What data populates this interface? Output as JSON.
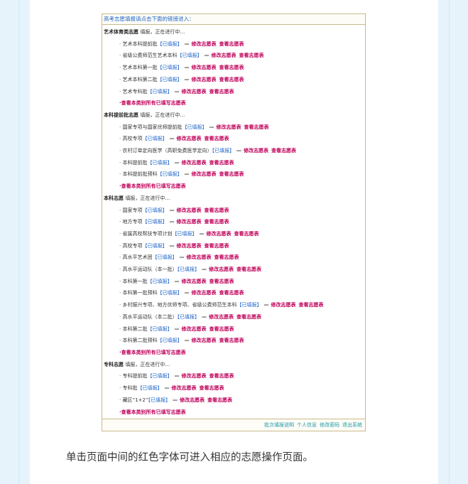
{
  "header": "高考志愿填报请点击下面的链接进入：",
  "status_text": "填报，正在进行中…",
  "filled_tag": "【已填报】",
  "dash": "—",
  "modify_label": "修改志愿表",
  "view_label": "查看志愿表",
  "view_all_label": "·查看本类别所有已填写志愿表",
  "sections": [
    {
      "title": "艺术体育类志愿",
      "items": [
        "艺术本科提前批",
        "省级公费师范生艺术本科",
        "艺术本科第一批",
        "艺术本科第二批",
        "艺术专科批"
      ]
    },
    {
      "title": "本科提前批志愿",
      "items": [
        "国家专项与国家优师提前批",
        "高校专项",
        "农村订单定向医学（高职免费医学定向）",
        "本科提前批",
        "本科提前批预科"
      ]
    },
    {
      "title": "本科志愿",
      "items": [
        "国家专项",
        "地方专项",
        "省属高校帮扶专项计划",
        "高校专项",
        "高水平艺术团",
        "高水平运动队（本一批）",
        "本科第一批",
        "本科第一批预科",
        "乡村振兴专项、地方优师专项、省级公费师范生本科",
        "高水平运动队（本二批）",
        "本科第二批",
        "本科第二批预科"
      ]
    },
    {
      "title": "专科志愿",
      "items": [
        "专科提前批",
        "专科批",
        "藏区“1+2”"
      ]
    }
  ],
  "footer_links": [
    "批次填报说明",
    "个人信息",
    "修改密码",
    "退出系统"
  ],
  "caption": "单击页面中间的红色字体可进入相应的志愿操作页面。"
}
